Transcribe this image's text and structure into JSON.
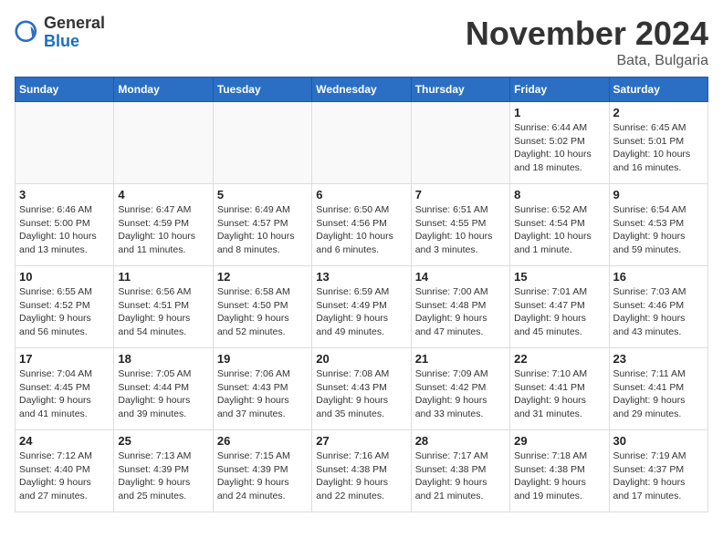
{
  "header": {
    "logo_general": "General",
    "logo_blue": "Blue",
    "month": "November 2024",
    "location": "Bata, Bulgaria"
  },
  "weekdays": [
    "Sunday",
    "Monday",
    "Tuesday",
    "Wednesday",
    "Thursday",
    "Friday",
    "Saturday"
  ],
  "weeks": [
    [
      {
        "day": "",
        "info": ""
      },
      {
        "day": "",
        "info": ""
      },
      {
        "day": "",
        "info": ""
      },
      {
        "day": "",
        "info": ""
      },
      {
        "day": "",
        "info": ""
      },
      {
        "day": "1",
        "info": "Sunrise: 6:44 AM\nSunset: 5:02 PM\nDaylight: 10 hours\nand 18 minutes."
      },
      {
        "day": "2",
        "info": "Sunrise: 6:45 AM\nSunset: 5:01 PM\nDaylight: 10 hours\nand 16 minutes."
      }
    ],
    [
      {
        "day": "3",
        "info": "Sunrise: 6:46 AM\nSunset: 5:00 PM\nDaylight: 10 hours\nand 13 minutes."
      },
      {
        "day": "4",
        "info": "Sunrise: 6:47 AM\nSunset: 4:59 PM\nDaylight: 10 hours\nand 11 minutes."
      },
      {
        "day": "5",
        "info": "Sunrise: 6:49 AM\nSunset: 4:57 PM\nDaylight: 10 hours\nand 8 minutes."
      },
      {
        "day": "6",
        "info": "Sunrise: 6:50 AM\nSunset: 4:56 PM\nDaylight: 10 hours\nand 6 minutes."
      },
      {
        "day": "7",
        "info": "Sunrise: 6:51 AM\nSunset: 4:55 PM\nDaylight: 10 hours\nand 3 minutes."
      },
      {
        "day": "8",
        "info": "Sunrise: 6:52 AM\nSunset: 4:54 PM\nDaylight: 10 hours\nand 1 minute."
      },
      {
        "day": "9",
        "info": "Sunrise: 6:54 AM\nSunset: 4:53 PM\nDaylight: 9 hours\nand 59 minutes."
      }
    ],
    [
      {
        "day": "10",
        "info": "Sunrise: 6:55 AM\nSunset: 4:52 PM\nDaylight: 9 hours\nand 56 minutes."
      },
      {
        "day": "11",
        "info": "Sunrise: 6:56 AM\nSunset: 4:51 PM\nDaylight: 9 hours\nand 54 minutes."
      },
      {
        "day": "12",
        "info": "Sunrise: 6:58 AM\nSunset: 4:50 PM\nDaylight: 9 hours\nand 52 minutes."
      },
      {
        "day": "13",
        "info": "Sunrise: 6:59 AM\nSunset: 4:49 PM\nDaylight: 9 hours\nand 49 minutes."
      },
      {
        "day": "14",
        "info": "Sunrise: 7:00 AM\nSunset: 4:48 PM\nDaylight: 9 hours\nand 47 minutes."
      },
      {
        "day": "15",
        "info": "Sunrise: 7:01 AM\nSunset: 4:47 PM\nDaylight: 9 hours\nand 45 minutes."
      },
      {
        "day": "16",
        "info": "Sunrise: 7:03 AM\nSunset: 4:46 PM\nDaylight: 9 hours\nand 43 minutes."
      }
    ],
    [
      {
        "day": "17",
        "info": "Sunrise: 7:04 AM\nSunset: 4:45 PM\nDaylight: 9 hours\nand 41 minutes."
      },
      {
        "day": "18",
        "info": "Sunrise: 7:05 AM\nSunset: 4:44 PM\nDaylight: 9 hours\nand 39 minutes."
      },
      {
        "day": "19",
        "info": "Sunrise: 7:06 AM\nSunset: 4:43 PM\nDaylight: 9 hours\nand 37 minutes."
      },
      {
        "day": "20",
        "info": "Sunrise: 7:08 AM\nSunset: 4:43 PM\nDaylight: 9 hours\nand 35 minutes."
      },
      {
        "day": "21",
        "info": "Sunrise: 7:09 AM\nSunset: 4:42 PM\nDaylight: 9 hours\nand 33 minutes."
      },
      {
        "day": "22",
        "info": "Sunrise: 7:10 AM\nSunset: 4:41 PM\nDaylight: 9 hours\nand 31 minutes."
      },
      {
        "day": "23",
        "info": "Sunrise: 7:11 AM\nSunset: 4:41 PM\nDaylight: 9 hours\nand 29 minutes."
      }
    ],
    [
      {
        "day": "24",
        "info": "Sunrise: 7:12 AM\nSunset: 4:40 PM\nDaylight: 9 hours\nand 27 minutes."
      },
      {
        "day": "25",
        "info": "Sunrise: 7:13 AM\nSunset: 4:39 PM\nDaylight: 9 hours\nand 25 minutes."
      },
      {
        "day": "26",
        "info": "Sunrise: 7:15 AM\nSunset: 4:39 PM\nDaylight: 9 hours\nand 24 minutes."
      },
      {
        "day": "27",
        "info": "Sunrise: 7:16 AM\nSunset: 4:38 PM\nDaylight: 9 hours\nand 22 minutes."
      },
      {
        "day": "28",
        "info": "Sunrise: 7:17 AM\nSunset: 4:38 PM\nDaylight: 9 hours\nand 21 minutes."
      },
      {
        "day": "29",
        "info": "Sunrise: 7:18 AM\nSunset: 4:38 PM\nDaylight: 9 hours\nand 19 minutes."
      },
      {
        "day": "30",
        "info": "Sunrise: 7:19 AM\nSunset: 4:37 PM\nDaylight: 9 hours\nand 17 minutes."
      }
    ]
  ]
}
